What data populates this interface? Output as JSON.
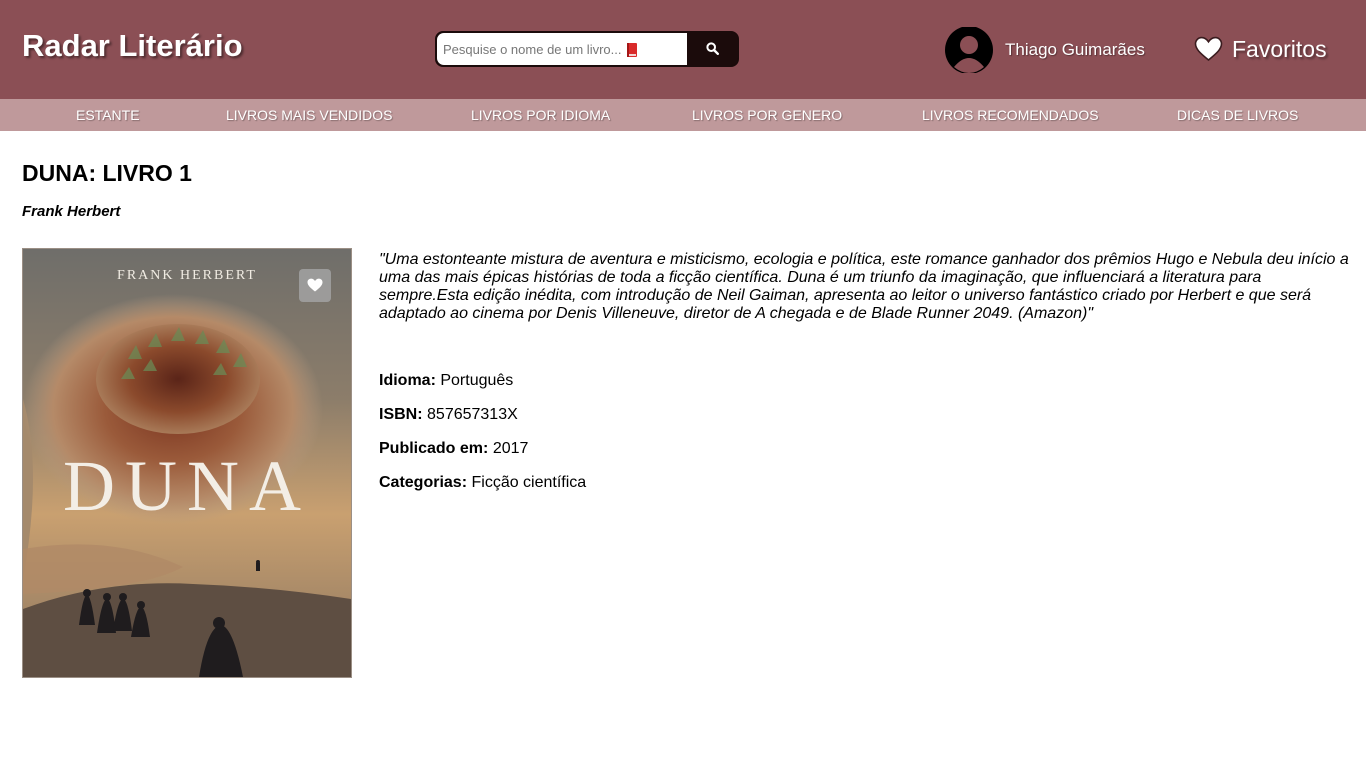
{
  "header": {
    "brand": "Radar Literário",
    "search": {
      "placeholder": "Pesquise o nome de um livro..."
    },
    "user": {
      "name": "Thiago Guimarães"
    },
    "favorites_label": "Favoritos"
  },
  "nav": {
    "items": [
      {
        "label": "ESTANTE"
      },
      {
        "label": "LIVROS MAIS VENDIDOS"
      },
      {
        "label": "LIVROS POR IDIOMA"
      },
      {
        "label": "LIVROS POR GENERO"
      },
      {
        "label": "LIVROS RECOMENDADOS"
      },
      {
        "label": "DICAS DE LIVROS"
      }
    ]
  },
  "book": {
    "title": "DUNA: LIVRO 1",
    "author": "Frank Herbert",
    "cover": {
      "author_text": "FRANK HERBERT",
      "title_text": "DUNA"
    },
    "description": "\"Uma estonteante mistura de aventura e misticismo, ecologia e política, este romance ganhador dos prêmios Hugo e Nebula deu início a uma das mais épicas histórias de toda a ficção científica. Duna é um triunfo da imaginação, que influenciará a literatura para sempre.Esta edição inédita, com introdução de Neil Gaiman, apresenta ao leitor o universo fantástico criado por Herbert e que será adaptado ao cinema por Denis Villeneuve, diretor de A chegada e de Blade Runner 2049. (Amazon)\"",
    "details": [
      {
        "label": "Idioma:",
        "value": "Português"
      },
      {
        "label": "ISBN:",
        "value": "857657313X"
      },
      {
        "label": "Publicado em:",
        "value": "2017"
      },
      {
        "label": "Categorias:",
        "value": "Ficção científica"
      }
    ]
  },
  "colors": {
    "header_bg": "#8b4f55",
    "nav_bg": "#bf999b",
    "search_button_bg": "#1b0b0b"
  },
  "icons": {
    "search": "search-icon",
    "avatar": "user-avatar-icon",
    "favorites": "heart-icon",
    "search_book": "red-book-icon"
  }
}
